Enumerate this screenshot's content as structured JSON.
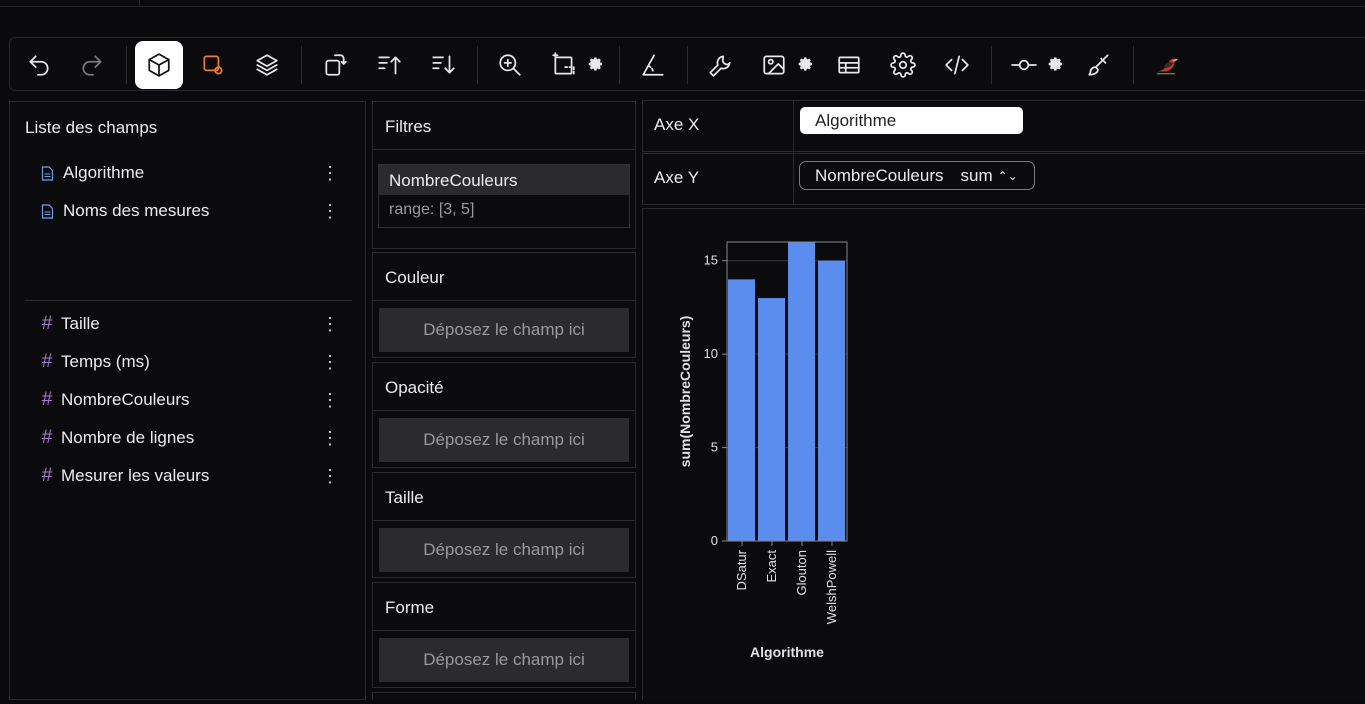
{
  "toolbar": {
    "buttons": [
      {
        "name": "undo-icon"
      },
      {
        "name": "redo-icon"
      },
      {
        "name": "cube-icon"
      },
      {
        "name": "select-shape-icon"
      },
      {
        "name": "layers-icon"
      },
      {
        "name": "transpose-icon"
      },
      {
        "name": "sort-ascending-icon"
      },
      {
        "name": "sort-descending-icon"
      },
      {
        "name": "zoom-icon"
      },
      {
        "name": "resize-icon"
      },
      {
        "name": "axis-icon"
      },
      {
        "name": "wrench-icon"
      },
      {
        "name": "image-icon"
      },
      {
        "name": "table-icon"
      },
      {
        "name": "gear-icon"
      },
      {
        "name": "code-icon"
      },
      {
        "name": "commit-icon"
      },
      {
        "name": "brush-icon"
      },
      {
        "name": "bird-logo-icon"
      }
    ]
  },
  "fields": {
    "title": "Liste des champs",
    "dimensions": [
      {
        "label": "Algorithme"
      },
      {
        "label": "Noms des mesures"
      }
    ],
    "measures": [
      {
        "label": "Taille"
      },
      {
        "label": "Temps (ms)"
      },
      {
        "label": "NombreCouleurs"
      },
      {
        "label": "Nombre de lignes"
      },
      {
        "label": "Mesurer les valeurs"
      }
    ]
  },
  "encodings": {
    "filters_title": "Filtres",
    "filter_name": "NombreCouleurs",
    "filter_range": "range: [3, 5]",
    "color_title": "Couleur",
    "opacity_title": "Opacité",
    "size_title": "Taille",
    "shape_title": "Forme",
    "drop_placeholder": "Déposez le champ ici"
  },
  "axes": {
    "x_label": "Axe X",
    "x_field": "Algorithme",
    "y_label": "Axe Y",
    "y_field": "NombreCouleurs",
    "y_agg": "sum",
    "y_sort_glyph": "⌃⌄"
  },
  "chart_data": {
    "type": "bar",
    "categories": [
      "DSatur",
      "Exact",
      "Glouton",
      "WelshPowell"
    ],
    "values": [
      14,
      13,
      16,
      15
    ],
    "xlabel": "Algorithme",
    "ylabel": "sum(NombreCouleurs)",
    "ylim": [
      0,
      16
    ],
    "yticks": [
      0,
      5,
      10,
      15
    ],
    "bar_color": "#5b8def",
    "grid": true
  }
}
